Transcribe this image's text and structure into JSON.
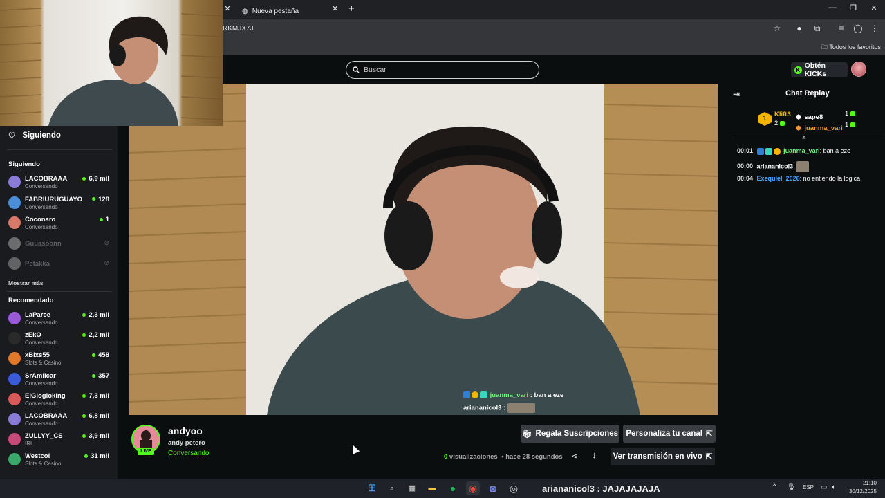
{
  "browser": {
    "tabs": [
      {
        "label": "Nueva pestaña"
      }
    ],
    "url": "RKMJX7J",
    "bookmarks_all": "Todos los favoritos"
  },
  "header": {
    "search_placeholder": "Buscar",
    "get_kicks": "Obtén KICKs"
  },
  "sidebar": {
    "following_title": "Siguiendo",
    "following_section": "Siguiendo",
    "following": [
      {
        "name": "LACOBRAAA",
        "sub": "Conversando",
        "viewers": "6,9 mil",
        "avatar": "#8a7bd6"
      },
      {
        "name": "FABRIURUGUAYO",
        "sub": "Conversando",
        "viewers": "128",
        "avatar": "#4a8fd8"
      },
      {
        "name": "Coconaro",
        "sub": "Conversando",
        "viewers": "1",
        "avatar": "#d87a6a"
      },
      {
        "name": "Guuasoonn",
        "offline": true,
        "avatar": "#cccccc"
      },
      {
        "name": "Petakka",
        "offline": true,
        "avatar": "#bbbbbb"
      }
    ],
    "show_more": "Mostrar más",
    "recommended_section": "Recomendado",
    "recommended": [
      {
        "name": "LaParce",
        "sub": "Conversando",
        "viewers": "2,3 mil",
        "avatar": "#9a5ad6"
      },
      {
        "name": "zEkO",
        "sub": "Conversando",
        "viewers": "2,2 mil",
        "avatar": "#2a2a2a"
      },
      {
        "name": "xBixs55",
        "sub": "Slots & Casino",
        "viewers": "458",
        "avatar": "#e07a2a"
      },
      {
        "name": "SrAmilcar",
        "sub": "Conversando",
        "viewers": "357",
        "avatar": "#3a5ad8"
      },
      {
        "name": "ElGlogloking",
        "sub": "Conversando",
        "viewers": "7,3 mil",
        "avatar": "#d85a5a"
      },
      {
        "name": "LACOBRAAA",
        "sub": "Conversando",
        "viewers": "6,8 mil",
        "avatar": "#8a7bd6"
      },
      {
        "name": "ZULLYY_CS",
        "sub": "IRL",
        "viewers": "3,9 mil",
        "avatar": "#c84a7a"
      },
      {
        "name": "Westcol",
        "sub": "Slots & Casino",
        "viewers": "31 mil",
        "avatar": "#3aa86a"
      }
    ]
  },
  "overlay_chat": [
    {
      "user": "juanma_vari",
      "text": " : ban a eze",
      "color": "#7cf08a"
    },
    {
      "user": "ariananicol3",
      "text": " :",
      "color": "#e8e8e8"
    }
  ],
  "stream": {
    "streamer": "andyoo",
    "title": "andy petero",
    "category": "Conversando",
    "live": "LIVE",
    "views_count": "0",
    "views_label": " visualizaciones",
    "time_ago": "• hace 28 segundos",
    "gift_button": "Regala Suscripciones",
    "customize_button": "Personaliza tu canal",
    "watch_live_button": "Ver transmisión en vivo"
  },
  "chat": {
    "title": "Chat Replay",
    "top_gifters": [
      {
        "name": "Klift3",
        "count": "2",
        "color": "#f5b400"
      },
      {
        "name": "sape8",
        "count": "1",
        "color": "#ffffff"
      },
      {
        "name": "juanma_vari",
        "count": "1",
        "color": "#f59a3a"
      }
    ],
    "rank": "1",
    "messages": [
      {
        "time": "00:01",
        "user": "juanma_vari",
        "text": ": ban a eze",
        "color": "#7cf08a"
      },
      {
        "time": "00:00",
        "user": "ariananicol3",
        "text": ":",
        "color": "#e8e8e8"
      },
      {
        "time": "00:04",
        "user": "Exequiel_2026",
        "text": ": no entiendo la logica",
        "color": "#4aa8ff"
      }
    ]
  },
  "taskbar": {
    "toast": "ariananicol3 : JAJAJAJAJA",
    "lang": "ESP",
    "time": "21:10",
    "date": "30/12/2025"
  }
}
